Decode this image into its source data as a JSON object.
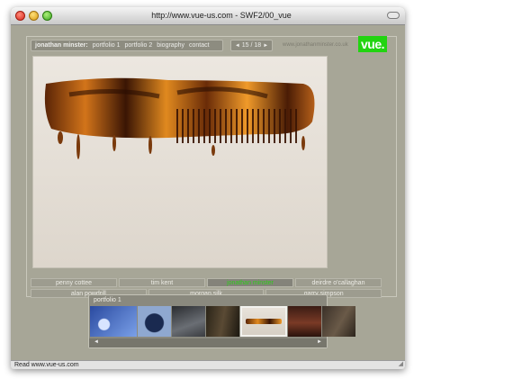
{
  "window": {
    "title": "http://www.vue-us.com - SWF2/00_vue"
  },
  "nav": {
    "name": "jonathan minster:",
    "links": [
      "portfolio 1",
      "portfolio 2",
      "biography",
      "contact"
    ]
  },
  "counter": {
    "prev": "◄",
    "text": "15 / 18",
    "next": "►"
  },
  "site_url": "www.jonathanminster.co.uk",
  "logo": "vue.",
  "photo": {
    "subject": "tortoiseshell comb"
  },
  "photographers": {
    "row1": [
      "penny cottee",
      "tim kent",
      "jonathan minster",
      "deirdre o'callaghan"
    ],
    "row2": [
      "alan powdrill",
      "morgan silk",
      "garry simpson"
    ],
    "active": "jonathan minster"
  },
  "strip": {
    "label": "portfolio 1",
    "prev": "◄",
    "next": "►"
  },
  "status": {
    "text": "Read www.vue-us.com"
  },
  "colors": {
    "accent": "#22d411",
    "window_bg": "#a7a697"
  }
}
